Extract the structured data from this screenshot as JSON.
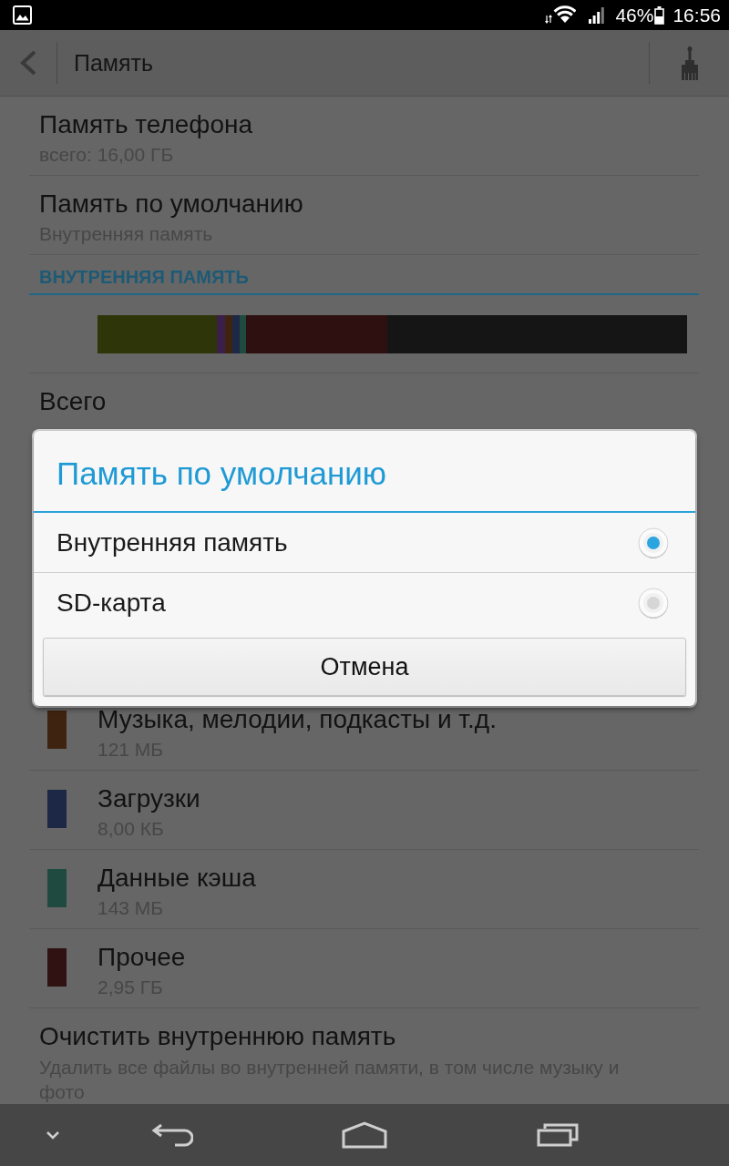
{
  "status_bar": {
    "battery": "46%",
    "time": "16:56"
  },
  "action_bar": {
    "title": "Память"
  },
  "settings": [
    {
      "title": "Память телефона",
      "summary": "всего: 16,00 ГБ"
    },
    {
      "title": "Память по умолчанию",
      "summary": "Внутренняя память"
    }
  ],
  "internal_storage": {
    "header": "ВНУТРЕННЯЯ ПАМЯТЬ",
    "usage_bar": [
      {
        "color": "#2e3508",
        "level": 0.2025
      },
      {
        "color": "#3a1f4a",
        "level": 0.014
      },
      {
        "color": "#3e2410",
        "level": 0.0124
      },
      {
        "color": "#1c2845",
        "level": 0.0124
      },
      {
        "color": "#1f4a40",
        "level": 0.0108
      },
      {
        "color": "#2e1010",
        "level": 0.24
      }
    ],
    "total": {
      "title": "Всего"
    },
    "categories": [
      {
        "title": "Музыка, мелодии, подкасты и т.д.",
        "size": "121 МБ",
        "color": "#3e2410"
      },
      {
        "title": "Загрузки",
        "size": "8,00 КБ",
        "color": "#1c2845"
      },
      {
        "title": "Данные кэша",
        "size": "143 МБ",
        "color": "#1f4a40"
      },
      {
        "title": "Прочее",
        "size": "2,95 ГБ",
        "color": "#311212"
      }
    ],
    "clear": {
      "title": "Очистить внутреннюю память",
      "summary": "Удалить все файлы во внутренней памяти, в том числе музыку и фото"
    }
  },
  "dialog": {
    "title": "Память по умолчанию",
    "options": [
      {
        "label": "Внутренняя память",
        "selected": true
      },
      {
        "label": "SD-карта",
        "selected": false
      }
    ],
    "button": "Отмена"
  }
}
